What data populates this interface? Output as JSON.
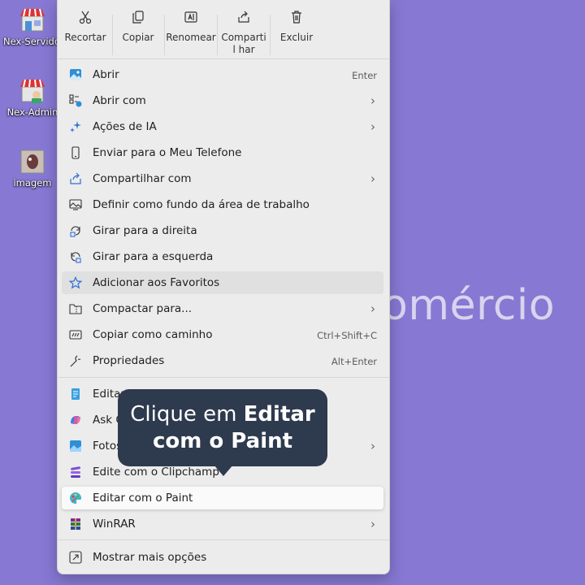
{
  "desktop": {
    "icons": [
      {
        "label": "Nex-Servidor",
        "icon": "store-icon"
      },
      {
        "label": "Nex-Admin",
        "icon": "store-admin-icon"
      },
      {
        "label": "imagem",
        "icon": "image-file-icon"
      }
    ],
    "background_text": "omércio"
  },
  "toolbar": [
    {
      "label": "Recortar",
      "icon": "scissors-icon"
    },
    {
      "label": "Copiar",
      "icon": "copy-icon"
    },
    {
      "label": "Renomear",
      "icon": "rename-icon"
    },
    {
      "label": "Compartil har",
      "icon": "share-icon"
    },
    {
      "label": "Excluir",
      "icon": "trash-icon"
    }
  ],
  "menu": {
    "items": [
      {
        "label": "Abrir",
        "shortcut": "Enter",
        "submenu": false,
        "icon": "image-open-icon"
      },
      {
        "label": "Abrir com",
        "shortcut": "",
        "submenu": true,
        "icon": "open-with-icon"
      },
      {
        "label": "Ações de IA",
        "shortcut": "",
        "submenu": true,
        "icon": "ai-sparkle-icon"
      },
      {
        "label": "Enviar para o Meu Telefone",
        "shortcut": "",
        "submenu": false,
        "icon": "phone-icon"
      },
      {
        "label": "Compartilhar com",
        "shortcut": "",
        "submenu": true,
        "icon": "share-with-icon"
      },
      {
        "label": "Definir como fundo da área de trabalho",
        "shortcut": "",
        "submenu": false,
        "icon": "wallpaper-icon"
      },
      {
        "label": "Girar para a direita",
        "shortcut": "",
        "submenu": false,
        "icon": "rotate-right-icon"
      },
      {
        "label": "Girar para a esquerda",
        "shortcut": "",
        "submenu": false,
        "icon": "rotate-left-icon"
      },
      {
        "label": "Adicionar aos Favoritos",
        "shortcut": "",
        "submenu": false,
        "icon": "star-icon"
      },
      {
        "label": "Compactar para...",
        "shortcut": "",
        "submenu": true,
        "icon": "zip-folder-icon"
      },
      {
        "label": "Copiar como caminho",
        "shortcut": "Ctrl+Shift+C",
        "submenu": false,
        "icon": "copy-path-icon"
      },
      {
        "label": "Propriedades",
        "shortcut": "Alt+Enter",
        "submenu": false,
        "icon": "wrench-icon"
      },
      {
        "label": "Editar",
        "shortcut": "",
        "submenu": false,
        "icon": "notepad-icon"
      },
      {
        "label": "Ask C",
        "shortcut": "",
        "submenu": false,
        "icon": "copilot-icon"
      },
      {
        "label": "Fotos",
        "shortcut": "",
        "submenu": true,
        "icon": "photos-icon"
      },
      {
        "label": "Edite com o Clipchamp",
        "shortcut": "",
        "submenu": false,
        "icon": "clipchamp-icon"
      },
      {
        "label": "Editar com o Paint",
        "shortcut": "",
        "submenu": false,
        "icon": "paint-icon"
      },
      {
        "label": "WinRAR",
        "shortcut": "",
        "submenu": true,
        "icon": "winrar-icon"
      },
      {
        "label": "Mostrar mais opções",
        "shortcut": "",
        "submenu": false,
        "icon": "more-options-icon"
      }
    ]
  },
  "tooltip": {
    "line1_prefix": "Clique em ",
    "line1_bold": "Editar",
    "line2_bold": "com o Paint"
  },
  "colors": {
    "desktop_bg": "#8678d3",
    "menu_bg": "#ececec",
    "tooltip_bg": "#2e3a4e",
    "highlight_bg": "#fafafa"
  }
}
